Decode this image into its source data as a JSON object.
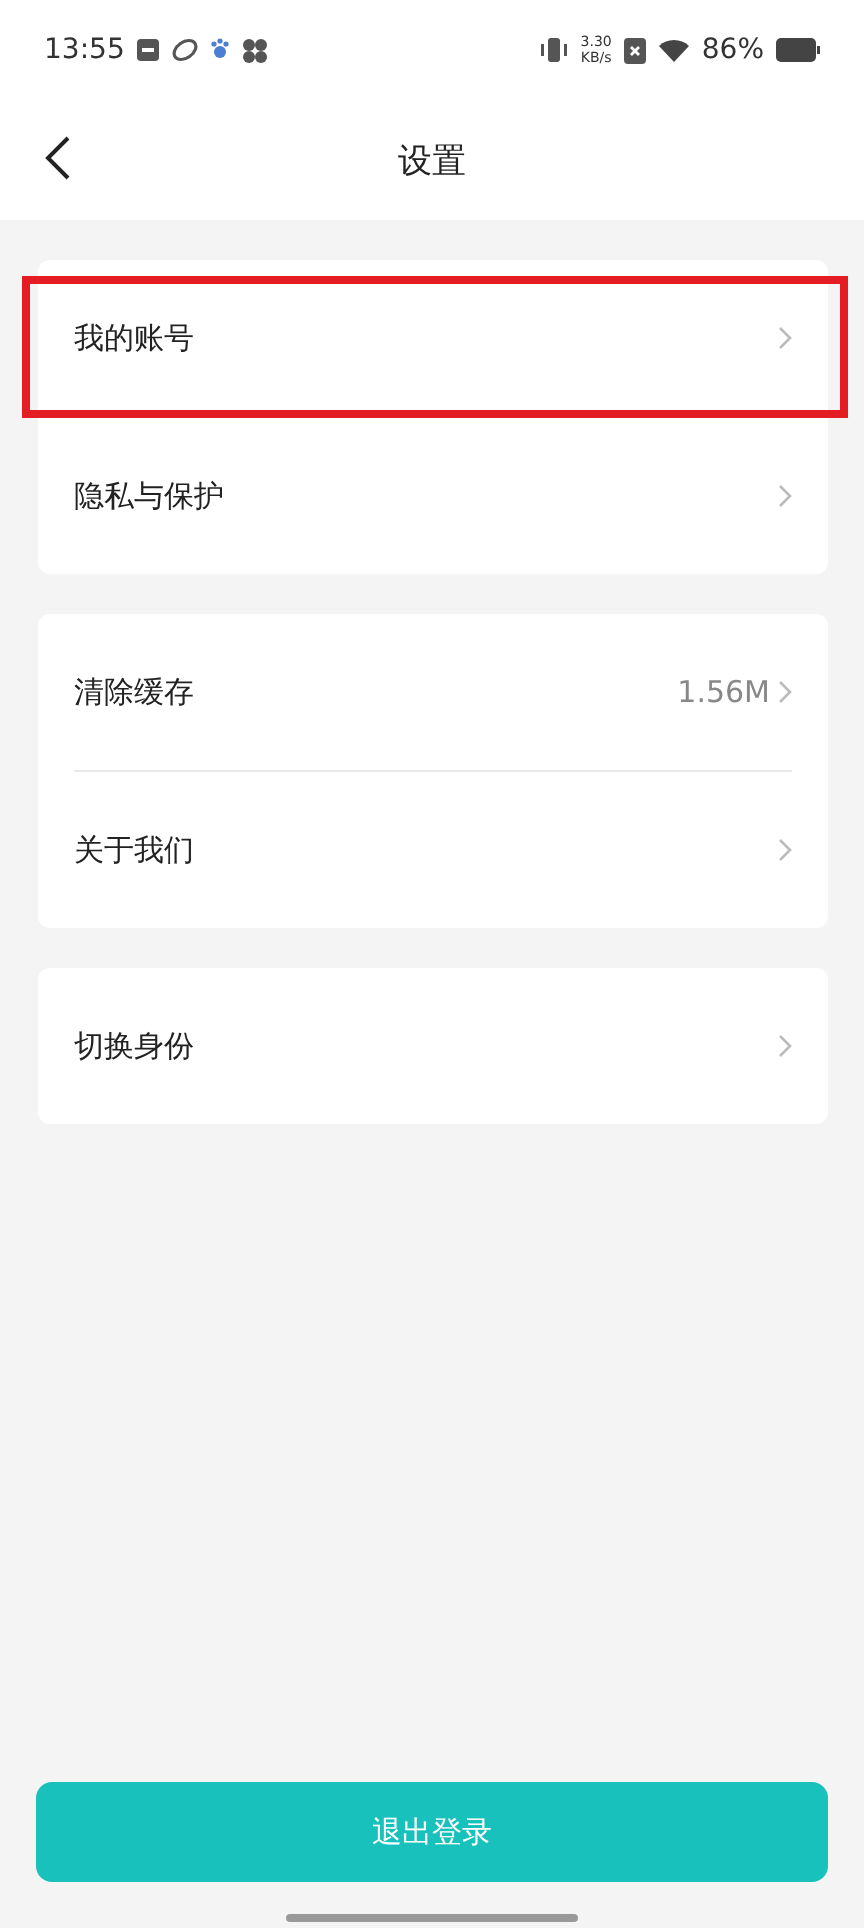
{
  "status_bar": {
    "time": "13:55",
    "net_speed_value": "3.30",
    "net_speed_unit": "KB/s",
    "battery": "86%"
  },
  "header": {
    "title": "设置"
  },
  "groups": [
    {
      "items": [
        {
          "label": "我的账号",
          "highlighted": true
        },
        {
          "label": "隐私与保护",
          "highlighted": false
        }
      ]
    },
    {
      "items": [
        {
          "label": "清除缓存",
          "value": "1.56M",
          "highlighted": false
        },
        {
          "label": "关于我们",
          "highlighted": false
        }
      ]
    },
    {
      "items": [
        {
          "label": "切换身份",
          "highlighted": false
        }
      ]
    }
  ],
  "logout_button": "退出登录"
}
